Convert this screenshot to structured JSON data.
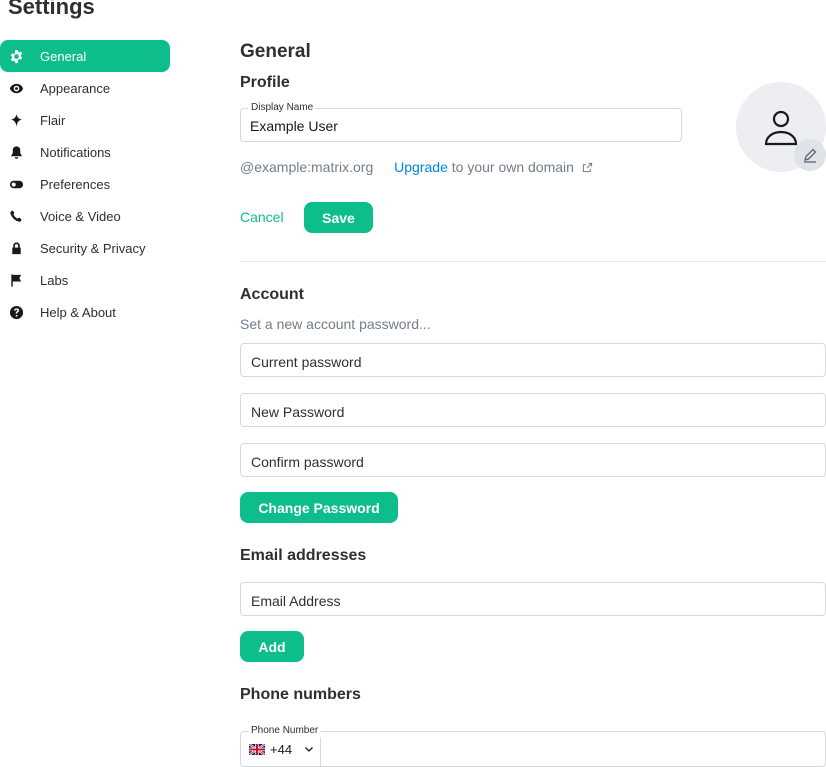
{
  "page": {
    "title": "Settings"
  },
  "sidebar": {
    "items": [
      {
        "label": "General",
        "icon": "gear-icon",
        "active": true
      },
      {
        "label": "Appearance",
        "icon": "eye-icon"
      },
      {
        "label": "Flair",
        "icon": "sparkle-icon"
      },
      {
        "label": "Notifications",
        "icon": "bell-icon"
      },
      {
        "label": "Preferences",
        "icon": "toggle-icon"
      },
      {
        "label": "Voice & Video",
        "icon": "phone-icon"
      },
      {
        "label": "Security & Privacy",
        "icon": "lock-icon"
      },
      {
        "label": "Labs",
        "icon": "flag-icon"
      },
      {
        "label": "Help & About",
        "icon": "help-icon"
      }
    ]
  },
  "general": {
    "heading": "General",
    "profile": {
      "heading": "Profile",
      "display_name_label": "Display Name",
      "display_name_value": "Example User",
      "mxid": "@example:matrix.org",
      "upgrade_link": "Upgrade",
      "upgrade_suffix": "to your own domain",
      "cancel_label": "Cancel",
      "save_label": "Save"
    },
    "account": {
      "heading": "Account",
      "subtext": "Set a new account password...",
      "current_password_placeholder": "Current password",
      "new_password_placeholder": "New Password",
      "confirm_password_placeholder": "Confirm password",
      "change_password_label": "Change Password"
    },
    "email": {
      "heading": "Email addresses",
      "placeholder": "Email Address",
      "add_label": "Add"
    },
    "phone": {
      "heading": "Phone numbers",
      "field_label": "Phone Number",
      "country_code": "+44"
    }
  },
  "colors": {
    "accent": "#0dbd8b",
    "link": "#0086e6",
    "muted": "#737d8c"
  }
}
